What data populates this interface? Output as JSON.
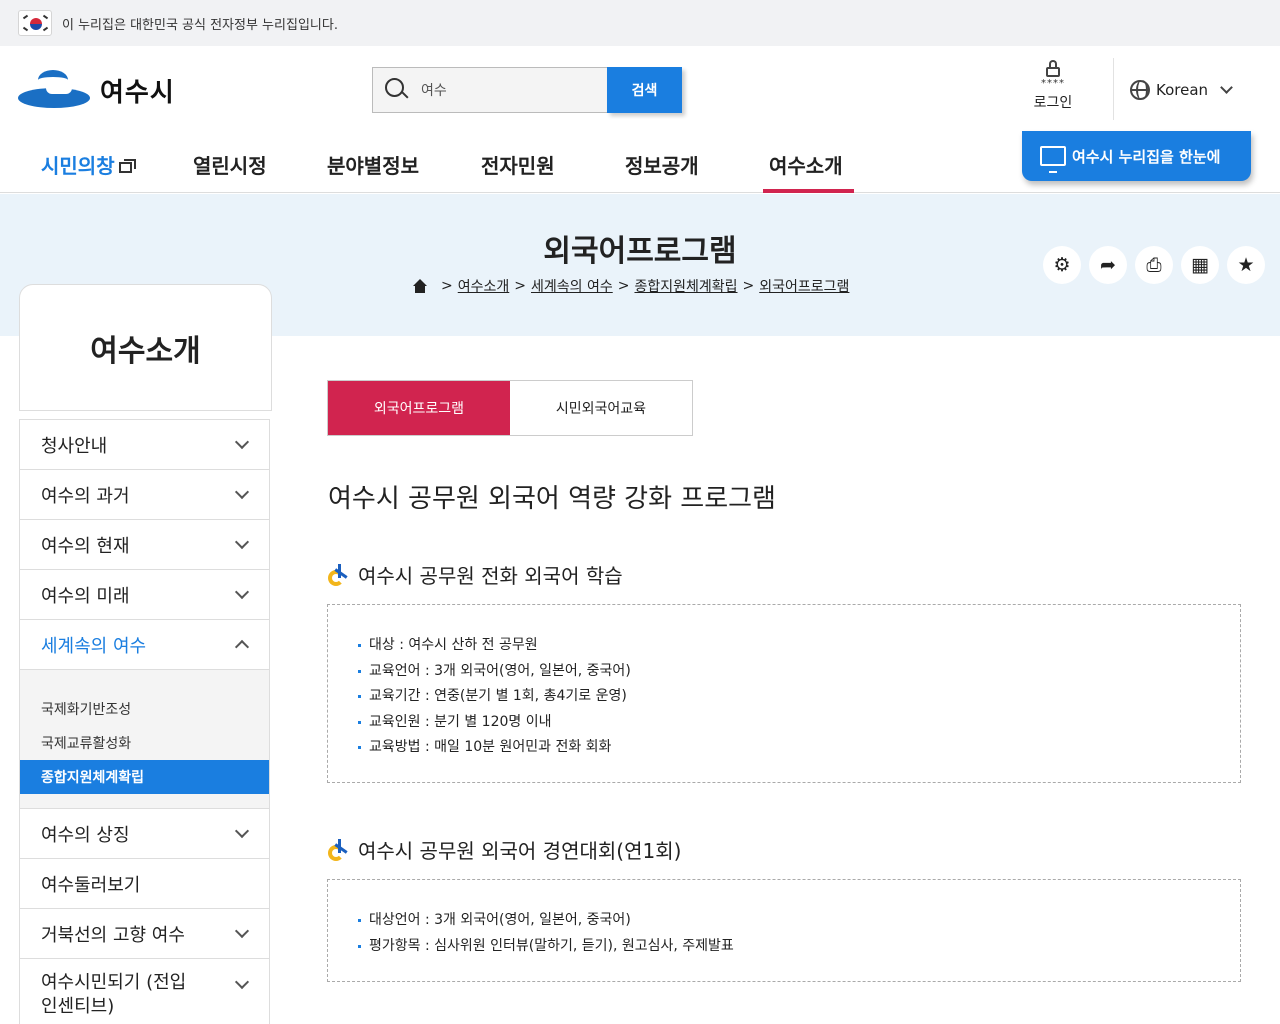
{
  "gov_banner": {
    "text": "이 누리집은 대한민국 공식 전자정부 누리집입니다."
  },
  "header": {
    "logo_text": "여수시",
    "search": {
      "value": "여수",
      "button": "검색"
    },
    "login": {
      "stars": "****",
      "label": "로그인"
    },
    "language": "Korean",
    "overview_button": "여수시 누리집을 한눈에"
  },
  "gnb": [
    {
      "label": "시민의창"
    },
    {
      "label": "열린시정"
    },
    {
      "label": "분야별정보"
    },
    {
      "label": "전자민원"
    },
    {
      "label": "정보공개"
    },
    {
      "label": "여수소개"
    }
  ],
  "page": {
    "title": "외국어프로그램",
    "breadcrumb": [
      "여수소개",
      "세계속의 여수",
      "종합지원체계확립",
      "외국어프로그램"
    ],
    "tools": [
      "gear-icon",
      "share-icon",
      "print-icon",
      "qr-icon",
      "star-icon"
    ]
  },
  "lnb": {
    "title": "여수소개",
    "items": [
      {
        "label": "청사안내"
      },
      {
        "label": "여수의 과거"
      },
      {
        "label": "여수의 현재"
      },
      {
        "label": "여수의 미래"
      },
      {
        "label": "세계속의 여수"
      },
      {
        "label": "여수의 상징"
      },
      {
        "label": "여수둘러보기"
      },
      {
        "label": "거북선의 고향 여수"
      },
      {
        "label": "여수시민되기 (전입인센티브)"
      }
    ],
    "sub_items": [
      {
        "label": "국제화기반조성"
      },
      {
        "label": "국제교류활성화"
      },
      {
        "label": "종합지원체계확립"
      }
    ]
  },
  "tabs": [
    {
      "label": "외국어프로그램"
    },
    {
      "label": "시민외국어교육"
    }
  ],
  "content": {
    "title": "여수시 공무원 외국어 역량 강화 프로그램",
    "sections": [
      {
        "title": "여수시 공무원 전화 외국어 학습",
        "bullets": [
          "대상 : 여수시 산하 전 공무원",
          "교육언어 : 3개 외국어(영어, 일본어, 중국어)",
          "교육기간 : 연중(분기 별 1회, 총4기로 운영)",
          "교육인원 : 분기 별 120명 이내",
          "교육방법 : 매일 10분 원어민과 전화 회화"
        ]
      },
      {
        "title": "여수시 공무원 외국어 경연대회(연1회)",
        "bullets": [
          "대상언어 : 3개 외국어(영어, 일본어, 중국어)",
          "평가항목 : 심사위원 인터뷰(말하기, 듣기), 원고심사, 주제발표"
        ]
      }
    ]
  },
  "colors": {
    "accent_blue": "#1a7ee0",
    "accent_red": "#d1244f",
    "band": "#eaf3fa"
  }
}
